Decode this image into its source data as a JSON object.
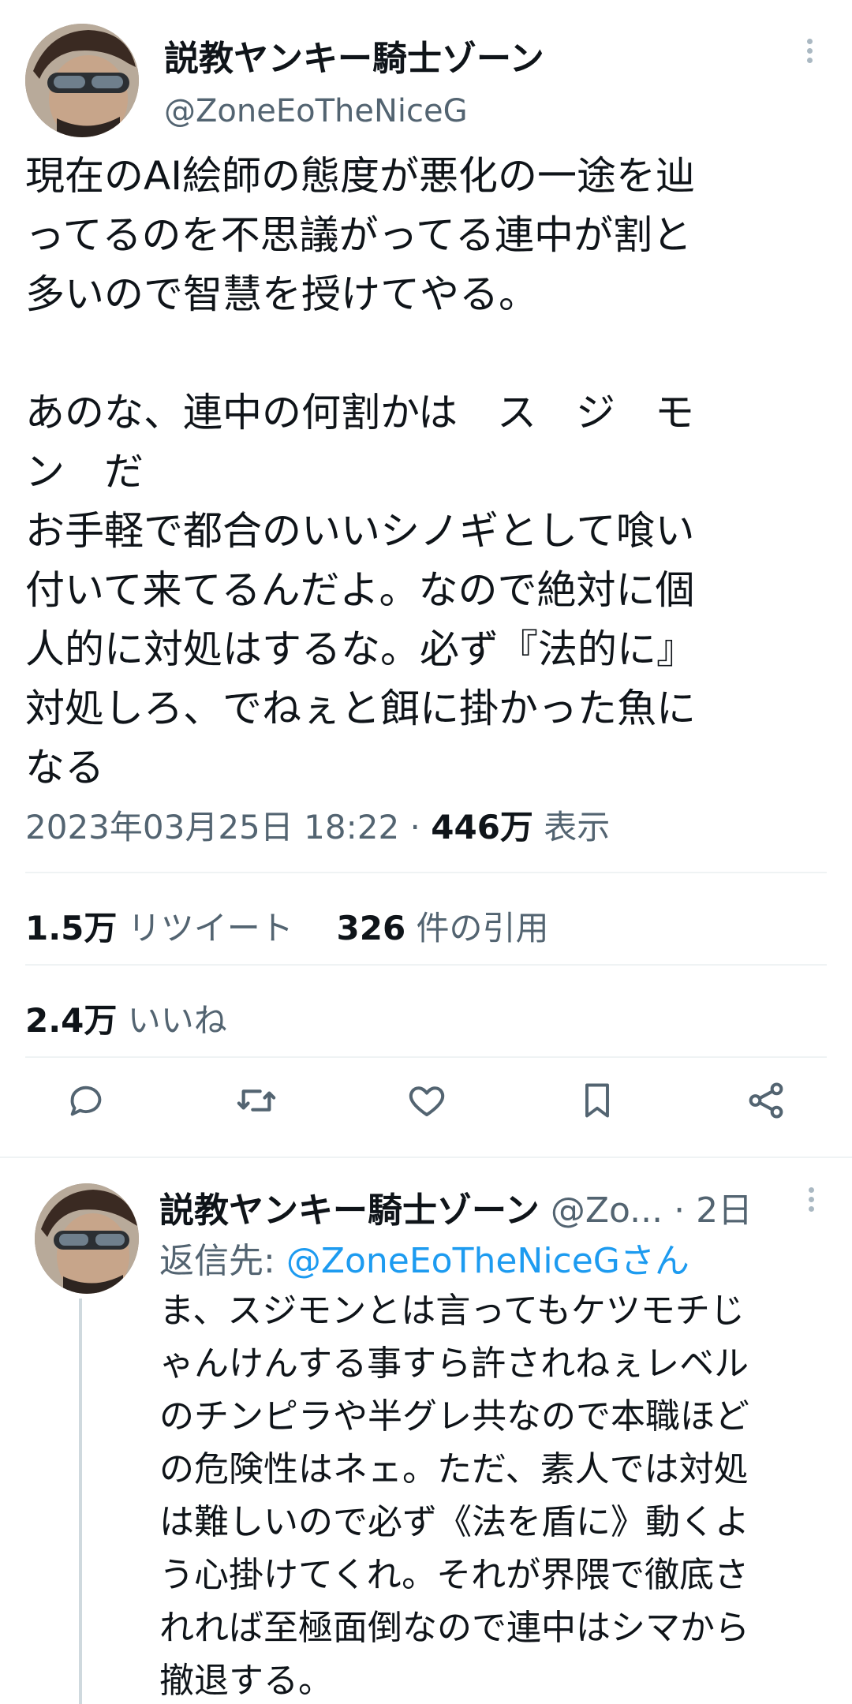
{
  "main_tweet": {
    "display_name": "説教ヤンキー騎士ゾーン",
    "handle": "@ZoneEoTheNiceG",
    "body_lines": [
      "現在のAI絵師の態度が悪化の一途を辿",
      "ってるのを不思議がってる連中が割と",
      "多いので智慧を授けてやる。",
      "",
      "あのな、連中の何割かは　ス　ジ　モ",
      "ン　だ",
      "お手軽で都合のいいシノギとして喰い",
      "付いて来てるんだよ。なので絶対に個",
      "人的に対処はするな。必ず『法的に』",
      "対処しろ、でねぇと餌に掛かった魚に",
      "なる"
    ],
    "timestamp": "2023年03月25日 18:22",
    "separator": "·",
    "views_count": "446万",
    "views_label": "表示",
    "retweets_count": "1.5万",
    "retweets_label": "リツイート",
    "quotes_count": "326",
    "quotes_label": "件の引用",
    "likes_count": "2.4万",
    "likes_label": "いいね",
    "actions": [
      "reply-icon",
      "retweet-icon",
      "like-icon",
      "bookmark-icon",
      "share-icon"
    ]
  },
  "reply": {
    "display_name": "説教ヤンキー騎士ゾーン",
    "handle_truncated": "@Zo...",
    "separator": "·",
    "time_ago": "2日",
    "replying_to_label": "返信先:",
    "replying_to_mention": "@ZoneEoTheNiceGさん",
    "body_lines": [
      "ま、スジモンとは言ってもケツモチじ",
      "ゃんけんする事すら許されねぇレベル",
      "のチンピラや半グレ共なので本職ほど",
      "の危険性はネェ。ただ、素人では対処",
      "は難しいので必ず《法を盾に》動くよ",
      "う心掛けてくれ。それが界隈で徹底さ",
      "れれば至極面倒なので連中はシマから",
      "撤退する。"
    ]
  },
  "colors": {
    "text_primary": "#0f1419",
    "text_secondary": "#536471",
    "link": "#1d9bf0",
    "divider": "#eff3f4",
    "icon": "#536471"
  }
}
